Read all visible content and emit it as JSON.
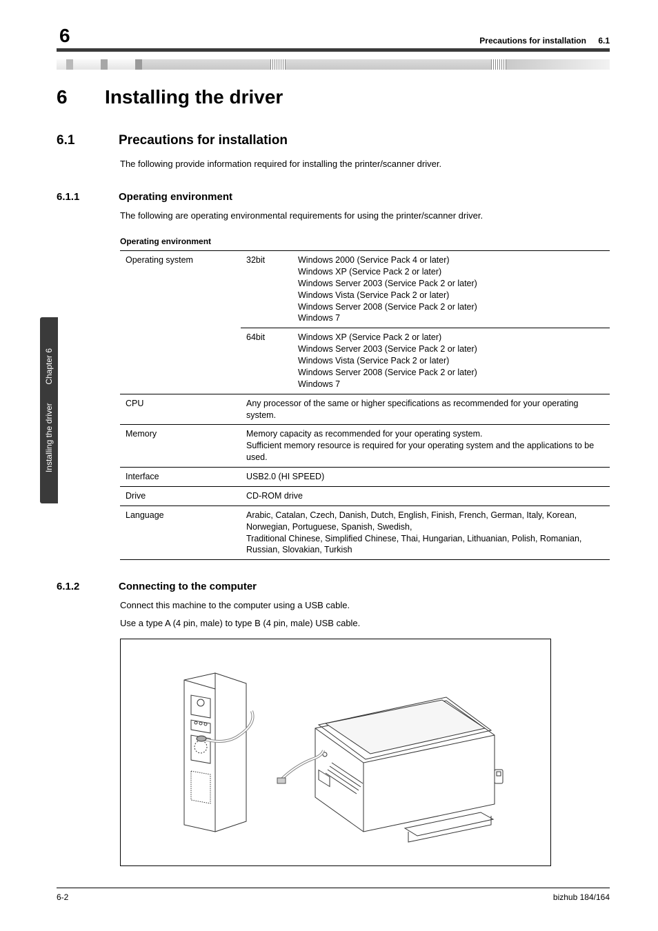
{
  "sidebar": {
    "chapter_label": "Chapter 6",
    "title": "Installing the driver"
  },
  "header": {
    "page_num": "6",
    "breadcrumb": "Precautions for installation",
    "section_ref": "6.1"
  },
  "chapter": {
    "num": "6",
    "title": "Installing the driver"
  },
  "s1": {
    "num": "6.1",
    "title": "Precautions for installation",
    "intro": "The following provide information required for installing the printer/scanner driver."
  },
  "s11": {
    "num": "6.1.1",
    "title": "Operating environment",
    "intro": "The following are operating environmental requirements for using the printer/scanner driver.",
    "table_title": "Operating environment",
    "rows": {
      "os_label": "Operating system",
      "os_32_label": "32bit",
      "os_32_val": "Windows 2000 (Service Pack 4 or later)\nWindows XP (Service Pack 2 or later)\nWindows Server 2003 (Service Pack 2 or later)\nWindows Vista (Service Pack 2 or later)\nWindows Server 2008 (Service Pack 2 or later)\nWindows 7",
      "os_64_label": "64bit",
      "os_64_val": "Windows XP (Service Pack 2 or later)\nWindows Server 2003 (Service Pack 2 or later)\nWindows Vista (Service Pack 2 or later)\nWindows Server 2008 (Service Pack 2 or later)\nWindows 7",
      "cpu_label": "CPU",
      "cpu_val": "Any processor of the same or higher specifications as recommended for your operating system.",
      "mem_label": "Memory",
      "mem_val": "Memory capacity as recommended for your operating system.\nSufficient memory resource is required for your operating system and the applications to be used.",
      "if_label": "Interface",
      "if_val": "USB2.0 (HI SPEED)",
      "drive_label": "Drive",
      "drive_val": "CD-ROM drive",
      "lang_label": "Language",
      "lang_val": "Arabic, Catalan, Czech, Danish, Dutch, English, Finish, French, German, Italy, Korean, Norwegian, Portuguese, Spanish, Swedish,\nTraditional Chinese, Simplified Chinese, Thai, Hungarian, Lithuanian, Polish, Romanian, Russian, Slovakian, Turkish"
    }
  },
  "s12": {
    "num": "6.1.2",
    "title": "Connecting to the computer",
    "p1": "Connect this machine to the computer using a USB cable.",
    "p2": "Use a type A (4 pin, male) to type B (4 pin, male) USB cable."
  },
  "footer": {
    "left": "6-2",
    "right": "bizhub 184/164"
  }
}
